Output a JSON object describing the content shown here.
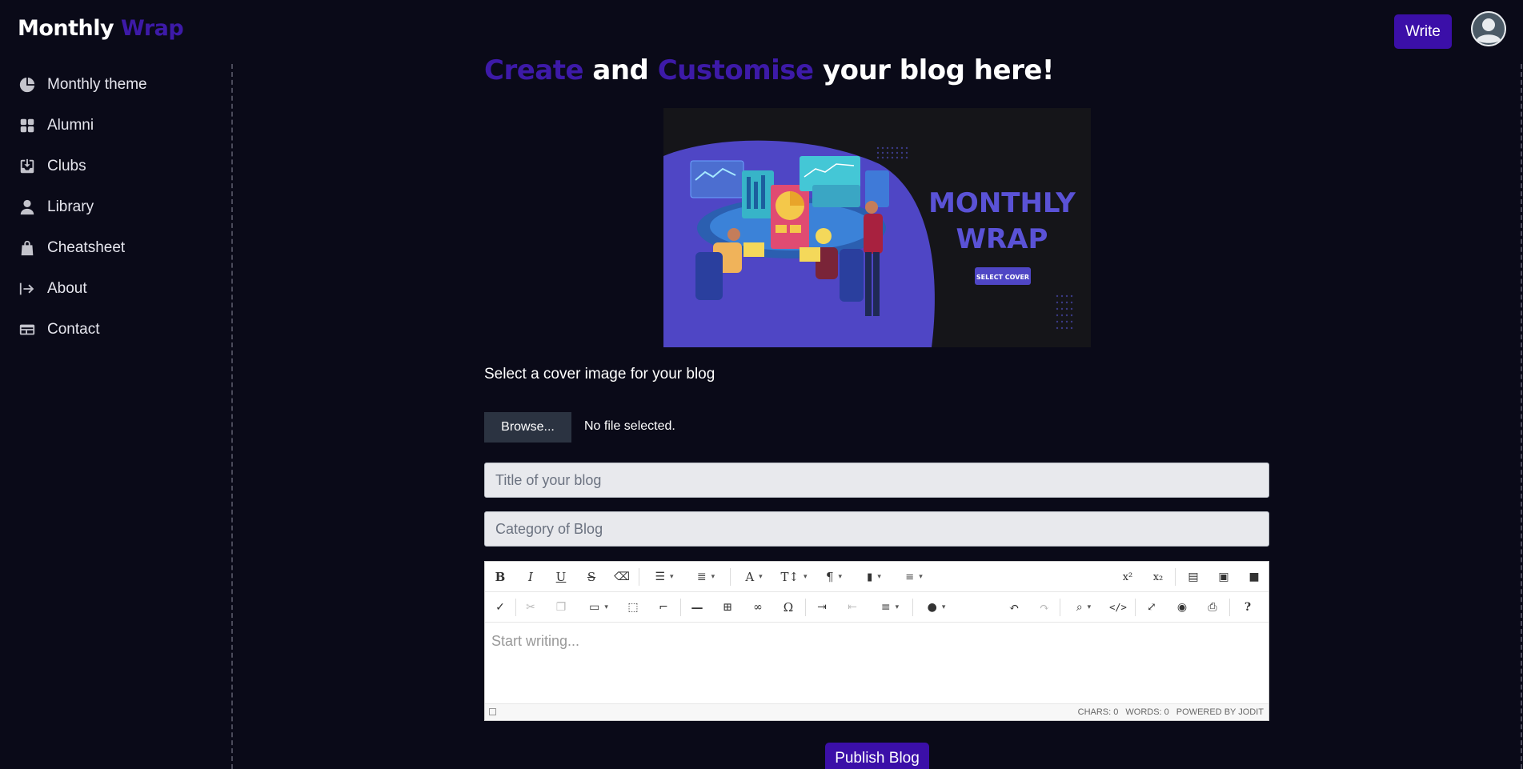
{
  "brand": {
    "part1": "Monthly",
    "part2": "Wrap"
  },
  "header": {
    "write_label": "Write"
  },
  "sidebar": {
    "items": [
      {
        "label": "Monthly theme",
        "icon": "pie-chart-icon"
      },
      {
        "label": "Alumni",
        "icon": "grid-icon"
      },
      {
        "label": "Clubs",
        "icon": "inbox-download-icon"
      },
      {
        "label": "Library",
        "icon": "user-icon"
      },
      {
        "label": "Cheatsheet",
        "icon": "shopping-bag-icon"
      },
      {
        "label": "About",
        "icon": "arrow-right-to-bar-icon"
      },
      {
        "label": "Contact",
        "icon": "id-card-icon"
      }
    ]
  },
  "heading": {
    "w1": "Create",
    "w2": " and ",
    "w3": "Customise",
    "w4": " your blog here!"
  },
  "cover": {
    "title_line1": "MONTHLY",
    "title_line2": "WRAP",
    "select_label": "SELECT COVER"
  },
  "cover_label": "Select a cover image for your blog",
  "file": {
    "browse_label": "Browse...",
    "status": "No file selected."
  },
  "form": {
    "title_placeholder": "Title of your blog",
    "category_placeholder": "Category of Blog"
  },
  "editor": {
    "placeholder": "Start writing...",
    "status": {
      "chars": "CHARS: 0",
      "words": "WORDS: 0",
      "powered": "POWERED BY JODIT"
    }
  },
  "publish_label": "Publish Blog",
  "colors": {
    "accent": "#3d1aa8",
    "button": "#3b0fa8",
    "background": "#0a0a18"
  }
}
